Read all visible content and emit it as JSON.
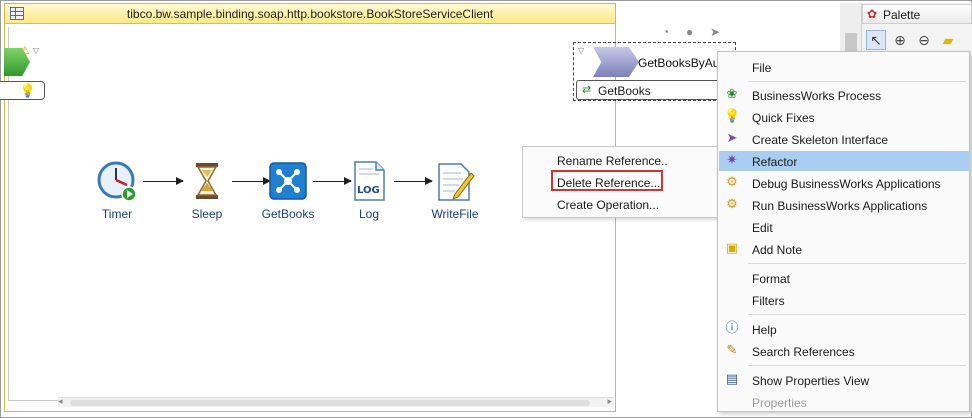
{
  "editor": {
    "title": "tibco.bw.sample.binding.soap.http.bookstore.BookStoreServiceClient"
  },
  "activities": [
    {
      "name": "Timer"
    },
    {
      "name": "Sleep"
    },
    {
      "name": "GetBooks"
    },
    {
      "name": "Log"
    },
    {
      "name": "WriteFile"
    }
  ],
  "log_icon_text": "LOG",
  "partner": {
    "name": "GetBooksByAuthor",
    "operation": "GetBooks"
  },
  "submenu": {
    "items": [
      "Rename Reference..",
      "Delete Reference...",
      "Create Operation..."
    ],
    "highlighted": "Delete Reference..."
  },
  "palette": {
    "title": "Palette"
  },
  "context_menu": {
    "items": [
      {
        "label": "File",
        "icon": "none"
      },
      {
        "label": "BusinessWorks Process",
        "icon": "bw-process-icon"
      },
      {
        "label": "Quick Fixes",
        "icon": "lightbulb-icon"
      },
      {
        "label": "Create Skeleton Interface",
        "icon": "skeleton-interface-icon"
      },
      {
        "label": "Refactor",
        "icon": "refactor-icon",
        "active": true
      },
      {
        "label": "Debug BusinessWorks Applications",
        "icon": "debug-icon"
      },
      {
        "label": "Run BusinessWorks Applications",
        "icon": "run-icon"
      },
      {
        "label": "Edit",
        "icon": "none"
      },
      {
        "label": "Add Note",
        "icon": "note-icon"
      },
      {
        "label": "Format",
        "icon": "none"
      },
      {
        "label": "Filters",
        "icon": "none"
      },
      {
        "label": "Help",
        "icon": "help-icon"
      },
      {
        "label": "Search References",
        "icon": "search-references-icon"
      },
      {
        "label": "Show Properties View",
        "icon": "properties-view-icon"
      },
      {
        "label": "Properties",
        "icon": "none",
        "disabled": true
      }
    ]
  },
  "colors": {
    "highlight_border": "#d9322f",
    "menu_active": "#a8cdf0",
    "editor_title_bg": "#fde98a",
    "activity_label": "#1a3e7a"
  }
}
